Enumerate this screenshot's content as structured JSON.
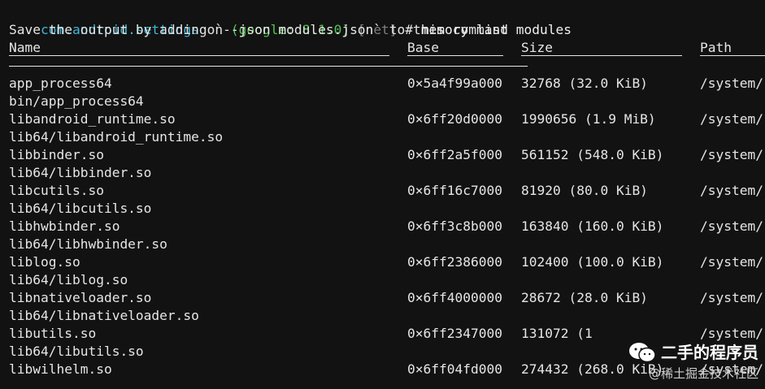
{
  "prompt": {
    "package": "com.android.settings",
    "on": " on ",
    "device": "(google: 8.1.0)",
    "transport": " [net]",
    "hash": " # ",
    "command": "memory list modules"
  },
  "hint": "Save the output by adding `--json modules.json` to this command",
  "headers": {
    "name": "Name",
    "base": "Base",
    "size": "Size",
    "path": "Path"
  },
  "modules": [
    {
      "name": "app_process64",
      "base": "0×5a4f99a000",
      "size": "32768 (32.0 KiB)",
      "path": "/system/",
      "wrap": "bin/app_process64"
    },
    {
      "name": "libandroid_runtime.so",
      "base": "0×6ff20d0000",
      "size": "1990656 (1.9 MiB)",
      "path": "/system/",
      "wrap": "lib64/libandroid_runtime.so"
    },
    {
      "name": "libbinder.so",
      "base": "0×6ff2a5f000",
      "size": "561152 (548.0 KiB)",
      "path": "/system/",
      "wrap": "lib64/libbinder.so"
    },
    {
      "name": "libcutils.so",
      "base": "0×6ff16c7000",
      "size": "81920 (80.0 KiB)",
      "path": "/system/",
      "wrap": "lib64/libcutils.so"
    },
    {
      "name": "libhwbinder.so",
      "base": "0×6ff3c8b000",
      "size": "163840 (160.0 KiB)",
      "path": "/system/",
      "wrap": "lib64/libhwbinder.so"
    },
    {
      "name": "liblog.so",
      "base": "0×6ff2386000",
      "size": "102400 (100.0 KiB)",
      "path": "/system/",
      "wrap": "lib64/liblog.so"
    },
    {
      "name": "libnativeloader.so",
      "base": "0×6ff4000000",
      "size": "28672 (28.0 KiB)",
      "path": "/system/",
      "wrap": "lib64/libnativeloader.so"
    },
    {
      "name": "libutils.so",
      "base": "0×6ff2347000",
      "size": "131072 (1",
      "path": "/system/",
      "wrap": "lib64/libutils.so"
    },
    {
      "name": "libwilhelm.so",
      "base": "0×6ff04fd000",
      "size": "274432 (268.0 KiB)",
      "path": "/system/",
      "wrap": ""
    }
  ],
  "watermark": {
    "title": "二手的程序员",
    "subtitle": "@稀土掘金技术社区",
    "icon": "wechat-icon"
  }
}
